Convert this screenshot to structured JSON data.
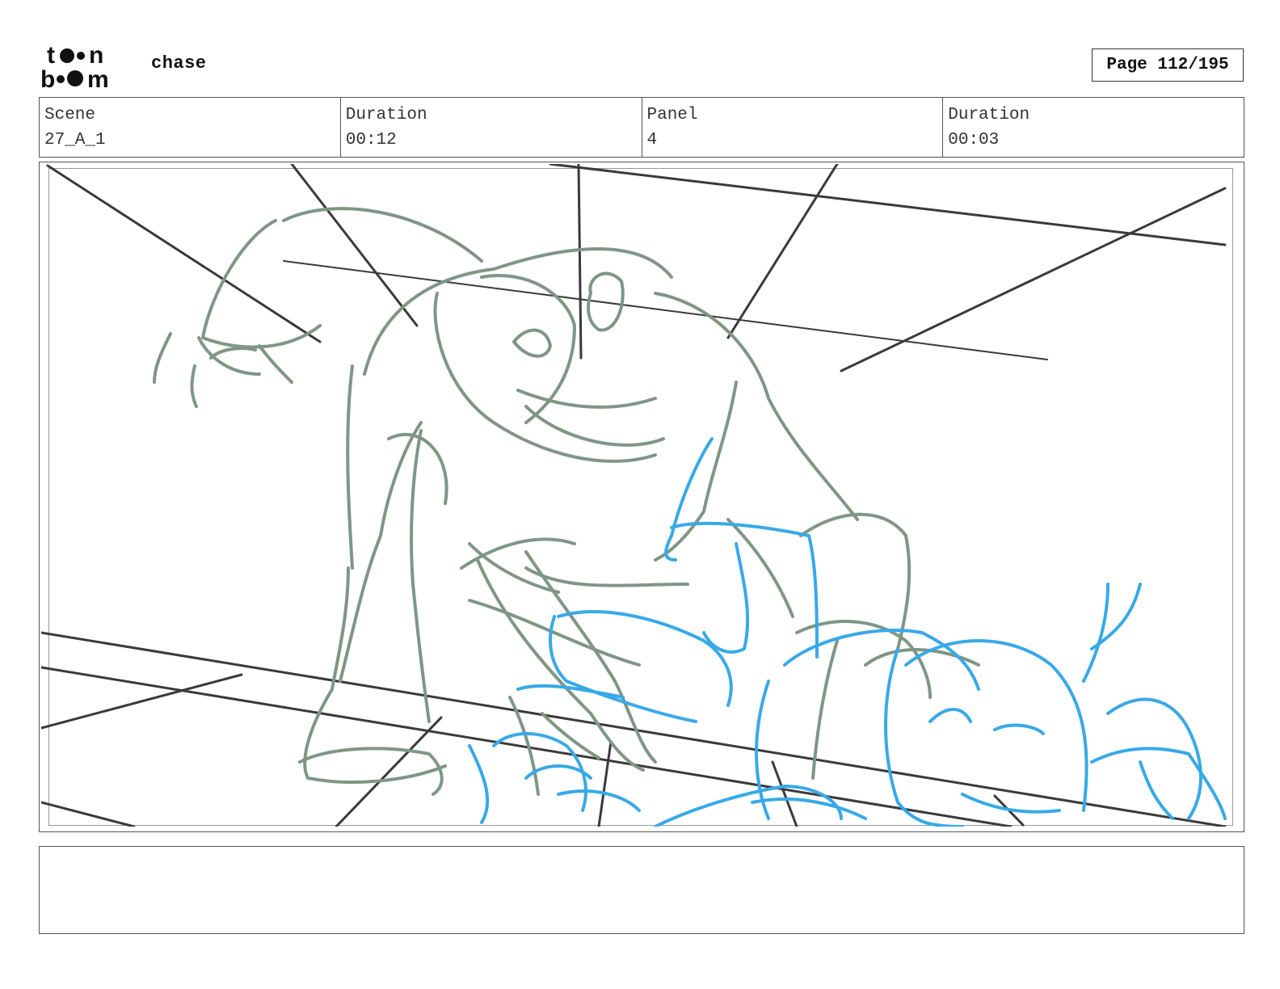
{
  "logo": {
    "brand": "toon boom"
  },
  "header": {
    "project_title": "chase",
    "page_label": "Page 112/195"
  },
  "info": {
    "scene_label": "Scene",
    "scene_value": "27_A_1",
    "scene_duration_label": "Duration",
    "scene_duration_value": "00:12",
    "panel_label": "Panel",
    "panel_value": "4",
    "panel_duration_label": "Duration",
    "panel_duration_value": "00:03"
  },
  "colors": {
    "perspective_lines": "#3a3a3a",
    "character_green": "#7f9684",
    "character_blue": "#38a9e8"
  },
  "notes": {
    "text": ""
  }
}
